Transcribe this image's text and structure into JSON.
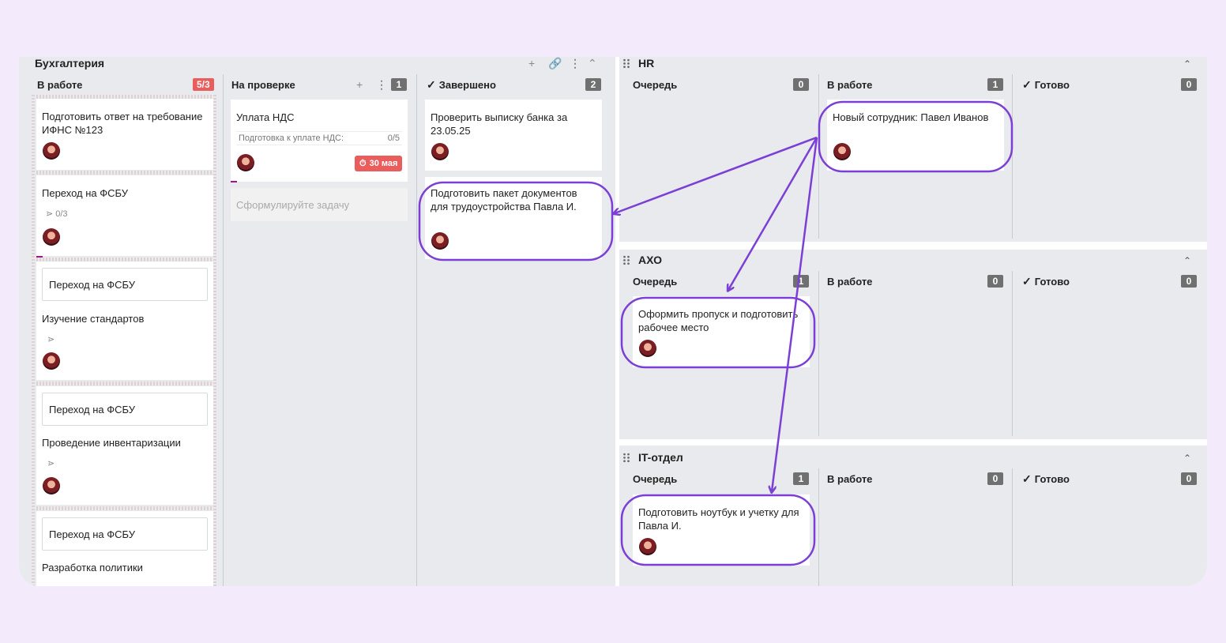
{
  "accounting": {
    "title": "Бухгалтерия",
    "columns": [
      {
        "label": "В работе",
        "count": "5/3"
      },
      {
        "label": "На проверке",
        "count": "1"
      },
      {
        "label": "Завершено",
        "count": "2"
      }
    ],
    "in_progress": {
      "card1": {
        "title": "Подготовить ответ на требование ИФНС №123"
      },
      "card2": {
        "title": "Переход на ФСБУ",
        "subtasks": "0/3"
      },
      "card3": {
        "parent": "Переход на ФСБУ",
        "title": "Изучение стандартов"
      },
      "card4": {
        "parent": "Переход на ФСБУ",
        "title": "Проведение инвентаризации"
      },
      "card5": {
        "parent": "Переход на ФСБУ",
        "title": "Разработка политики"
      }
    },
    "review": {
      "card1": {
        "title": "Уплата НДС",
        "checklist_label": "Подготовка к уплате НДС:",
        "checklist_progress": "0/5",
        "due": "30 мая"
      },
      "new_task_placeholder": "Сформулируйте задачу"
    },
    "done": {
      "card1": {
        "title": "Проверить выписку банка за 23.05.25"
      },
      "card2": {
        "title": "Подготовить пакет документов для трудоустройства Павла И."
      }
    }
  },
  "hr": {
    "title": "HR",
    "columns": [
      {
        "label": "Очередь",
        "count": "0"
      },
      {
        "label": "В работе",
        "count": "1"
      },
      {
        "label": "Готово",
        "count": "0"
      }
    ],
    "card1": {
      "title": "Новый сотрудник: Павел Иванов"
    }
  },
  "axo": {
    "title": "АХО",
    "columns": [
      {
        "label": "Очередь",
        "count": "1"
      },
      {
        "label": "В работе",
        "count": "0"
      },
      {
        "label": "Готово",
        "count": "0"
      }
    ],
    "card1": {
      "title": "Оформить пропуск и подготовить рабочее место"
    }
  },
  "it": {
    "title": "IT-отдел",
    "columns": [
      {
        "label": "Очередь",
        "count": "1"
      },
      {
        "label": "В работе",
        "count": "0"
      },
      {
        "label": "Готово",
        "count": "0"
      }
    ],
    "card1": {
      "title": "Подготовить ноутбук и учетку для Павла И."
    }
  },
  "colors": {
    "accent_purple": "#7b3fd6",
    "overdue_red": "#e95d5d",
    "count_gray": "#707070",
    "background": "#f3eafc"
  },
  "icons": [
    "plus-icon",
    "link-icon",
    "more-icon",
    "chevron-up-icon",
    "check-icon",
    "drag-handle-icon",
    "subtasks-icon",
    "timer-icon",
    "avatar"
  ]
}
